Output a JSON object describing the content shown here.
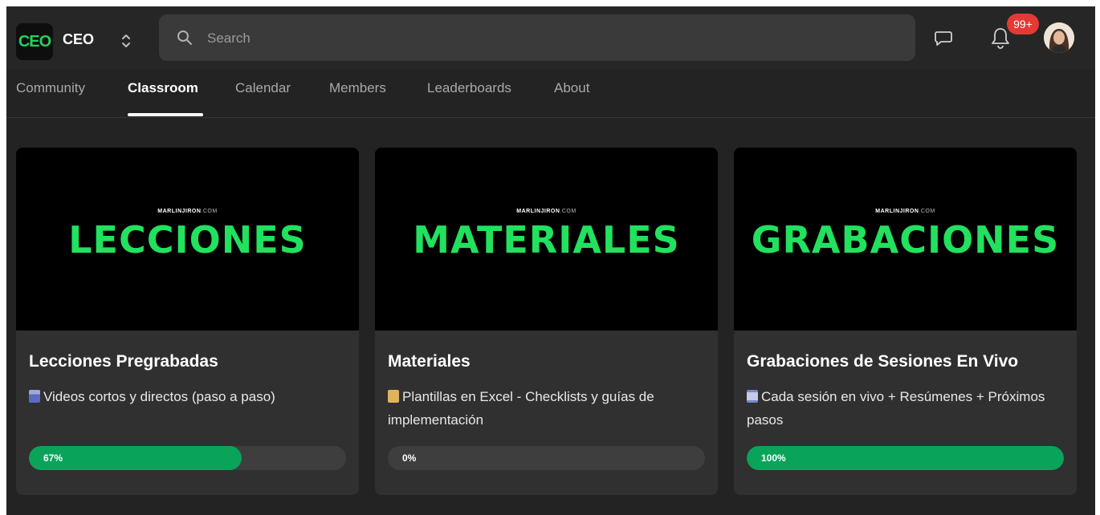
{
  "header": {
    "logo_text": "CEO",
    "org_name": "CEO",
    "search_placeholder": "Search",
    "notifications_badge": "99+"
  },
  "tabs": [
    {
      "label": "Community",
      "active": false
    },
    {
      "label": "Classroom",
      "active": true
    },
    {
      "label": "Calendar",
      "active": false
    },
    {
      "label": "Members",
      "active": false
    },
    {
      "label": "Leaderboards",
      "active": false
    },
    {
      "label": "About",
      "active": false
    }
  ],
  "courses": [
    {
      "banner_brand": "MARLINJIRON",
      "banner_brand_suffix": ".COM",
      "banner_title": "LECCIONES",
      "title": "Lecciones Pregrabadas",
      "description": "Videos cortos y directos (paso a paso)",
      "progress": 67,
      "progress_label": "67%"
    },
    {
      "banner_brand": "MARLINJIRON",
      "banner_brand_suffix": ".COM",
      "banner_title": "MATERIALES",
      "title": "Materiales",
      "description": "Plantillas en Excel - Checklists y guías de implementación",
      "progress": 0,
      "progress_label": "0%"
    },
    {
      "banner_brand": "MARLINJIRON",
      "banner_brand_suffix": ".COM",
      "banner_title": "GRABACIONES",
      "title": "Grabaciones de Sesiones En Vivo",
      "description": "Cada sesión en vivo + Resúmenes + Próximos pasos",
      "progress": 100,
      "progress_label": "100%"
    }
  ],
  "colors": {
    "background": "#232323",
    "accent_green": "#21e15e",
    "progress_green": "#0aa35a",
    "badge_red": "#e53935"
  },
  "icons": [
    "chevron-updown-icon",
    "search-icon",
    "chat-icon",
    "bell-icon"
  ]
}
